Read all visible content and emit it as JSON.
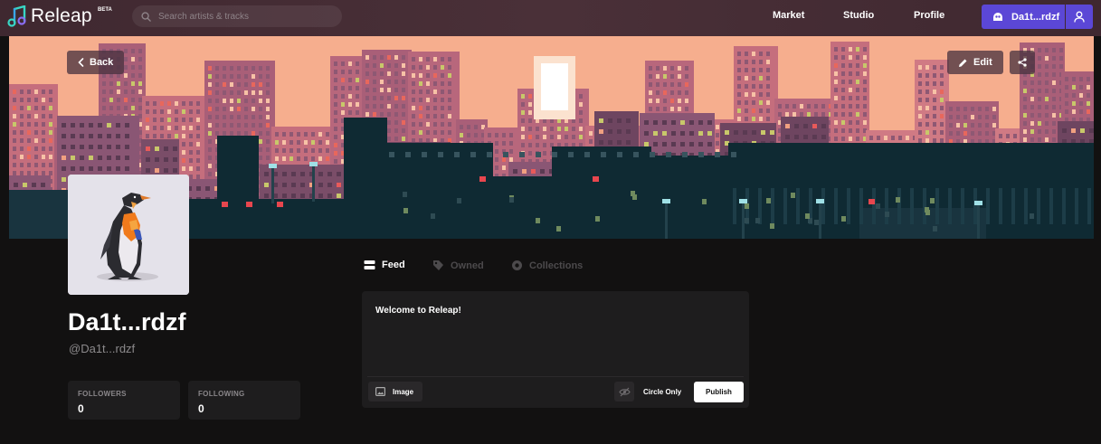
{
  "brand": {
    "name": "Releap",
    "badge": "BETA"
  },
  "search": {
    "placeholder": "Search artists & tracks"
  },
  "nav": {
    "market": "Market",
    "studio": "Studio",
    "profile": "Profile"
  },
  "user_menu": {
    "name": "Da1t...rdzf"
  },
  "banner": {
    "back_label": "Back",
    "edit_label": "Edit"
  },
  "profile": {
    "display_name": "Da1t...rdzf",
    "handle": "@Da1t...rdzf",
    "followers_label": "FOLLOWERS",
    "followers_value": "0",
    "following_label": "FOLLOWING",
    "following_value": "0"
  },
  "tabs": [
    {
      "label": "Feed",
      "icon": "feed-icon",
      "active": true
    },
    {
      "label": "Owned",
      "icon": "tag-icon",
      "active": false
    },
    {
      "label": "Collections",
      "icon": "collections-icon",
      "active": false
    }
  ],
  "composer": {
    "text": "Welcome to Releap!",
    "image_label": "Image",
    "circle_label": "Circle Only",
    "publish_label": "Publish"
  },
  "colors": {
    "accent": "#5b47d6",
    "background": "#121111",
    "card": "#1e1d1e",
    "topbar": "#4a3038"
  }
}
